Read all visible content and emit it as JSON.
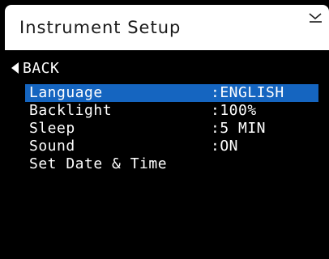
{
  "header": {
    "title": "Instrument Setup",
    "corner_icon": "minimize-icon"
  },
  "back": {
    "label": "BACK",
    "icon": "left-triangle-icon"
  },
  "menu": {
    "items": [
      {
        "label": "Language",
        "value": ":ENGLISH",
        "selected": true
      },
      {
        "label": "Backlight",
        "value": ":100%",
        "selected": false
      },
      {
        "label": "Sleep",
        "value": ":5 MIN",
        "selected": false
      },
      {
        "label": "Sound",
        "value": ":ON",
        "selected": false
      },
      {
        "label": "Set Date & Time",
        "value": "",
        "selected": false
      }
    ]
  },
  "colors": {
    "background": "#000000",
    "header_background": "#ffffff",
    "selection": "#1565c0",
    "text": "#ffffff"
  }
}
